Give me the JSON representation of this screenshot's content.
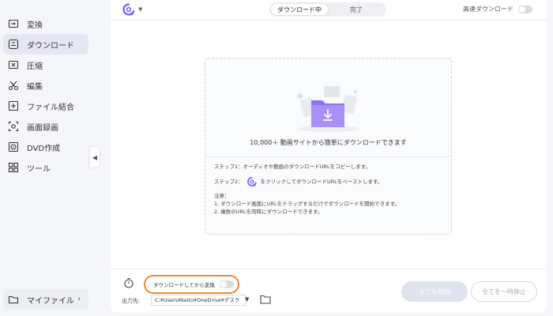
{
  "sidebar": {
    "items": [
      {
        "label": "変換",
        "icon": "convert-icon"
      },
      {
        "label": "ダウンロード",
        "icon": "download-icon",
        "active": true
      },
      {
        "label": "圧縮",
        "icon": "compress-icon"
      },
      {
        "label": "編集",
        "icon": "scissors-icon"
      },
      {
        "label": "ファイル結合",
        "icon": "merge-icon"
      },
      {
        "label": "画面録画",
        "icon": "screen-record-icon"
      },
      {
        "label": "DVD作成",
        "icon": "dvd-icon"
      },
      {
        "label": "ツール",
        "icon": "tools-icon"
      }
    ],
    "my_files_label": "マイファイル",
    "my_files_arrow": "›"
  },
  "topbar": {
    "tabs": [
      "ダウンロード中",
      "完了"
    ],
    "active_tab": 0,
    "high_speed_label": "高速ダウンロード"
  },
  "dropzone": {
    "title": "10,000＋ 動画サイトから簡単にダウンロードできます",
    "step1": "ステップ1：オーディオや動画のダウンロードURLをコピーします。",
    "step2_prefix": "ステップ2：",
    "step2_suffix": "をクリックしてダウンロードURLをペーストします。",
    "note_title": "注意：",
    "note1": "1. ダウンロード画面にURLをドラッグするだけでダウンロードを開始できます。",
    "note2": "2. 複数のURLを同時にダウンロードできます。"
  },
  "bottom": {
    "convert_after_label": "ダウンロードしてから変換",
    "output_label": "出力先:",
    "output_path": "C:¥Users¥keito¥OneDrive¥デスク",
    "start_all_label": "全てを開始",
    "pause_all_label": "全てを一時停止"
  },
  "colors": {
    "accent": "#7b5cf5",
    "highlight": "#f08a2c",
    "folder": "#8f72f2"
  }
}
